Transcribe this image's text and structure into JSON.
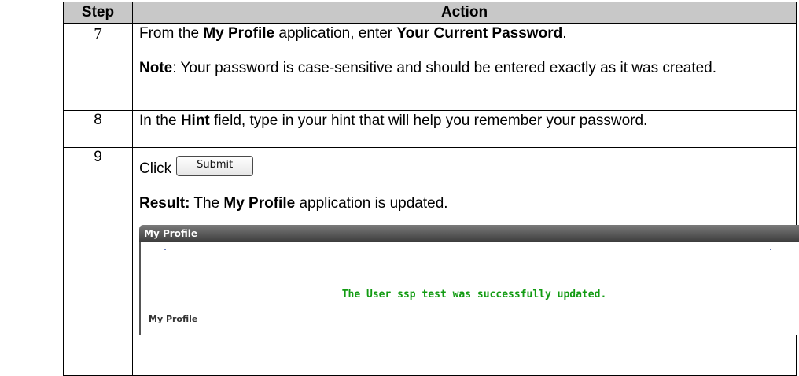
{
  "table": {
    "headers": {
      "step": "Step",
      "action": "Action"
    },
    "rows": [
      {
        "step": "7",
        "line1": {
          "t1": "From the ",
          "b1": "My Profile",
          "t2": " application, enter ",
          "b2": "Your Current Password",
          "t3": "."
        },
        "note": {
          "label": "Note",
          "text": ":  Your password is case-sensitive and should be entered exactly as it was created."
        }
      },
      {
        "step": "8",
        "line1": {
          "t1": "In the ",
          "b1": "Hint",
          "t2": " field, type in your hint that will help you remember your password."
        }
      },
      {
        "step": "9",
        "click_label": "Click",
        "submit_button": "Submit",
        "result": {
          "label": "Result:",
          "t1": "  The ",
          "b1": "My Profile",
          "t2": " application is updated."
        },
        "screenshot": {
          "header_title": "My Profile",
          "success_message": "The User ssp test was successfully updated.",
          "subheading": "My Profile"
        }
      }
    ]
  }
}
